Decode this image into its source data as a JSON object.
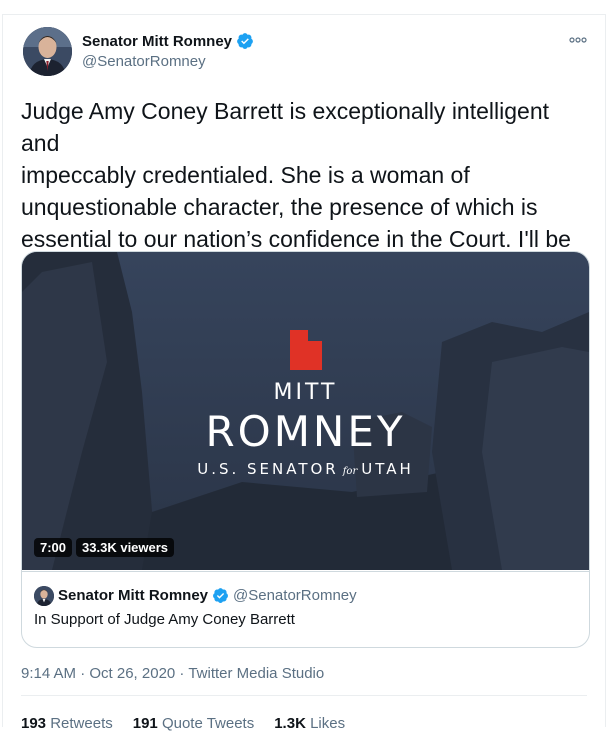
{
  "tweet": {
    "author_name": "Senator Mitt Romney",
    "author_handle": "@SenatorRomney",
    "text": "Judge Amy Coney Barrett is exceptionally intelligent and\nimpeccably credentialed. She is a woman of\nunquestionable character, the presence of which is\nessential to our nation’s confidence in the Court. I'll be\nhonored to vote to confirm her nomination.",
    "timestamp": "9:14 AM · Oct 26, 2020",
    "separator": " · ",
    "source": "Twitter Media Studio"
  },
  "video": {
    "logo_first": "MITT",
    "logo_last": "ROMNEY",
    "logo_sub_left": "U.S. SENATOR",
    "logo_sub_for": "for",
    "logo_sub_right": "UTAH",
    "duration": "7:00",
    "viewers": "33.3K viewers",
    "embed_name": "Senator Mitt Romney",
    "embed_handle": "@SenatorRomney",
    "embed_description": "In Support of Judge Amy Coney Barrett"
  },
  "stats": {
    "retweets_count": "193",
    "retweets_label": "Retweets",
    "quotes_count": "191",
    "quotes_label": "Quote Tweets",
    "likes_count": "1.3K",
    "likes_label": "Likes"
  },
  "icons": {
    "verified": "verified-badge-icon",
    "more": "more-options-icon"
  },
  "colors": {
    "verified_blue": "#1da1f2",
    "secondary_text": "#5b7083",
    "logo_red": "#e03226",
    "video_bg": "#2e3a4f"
  }
}
